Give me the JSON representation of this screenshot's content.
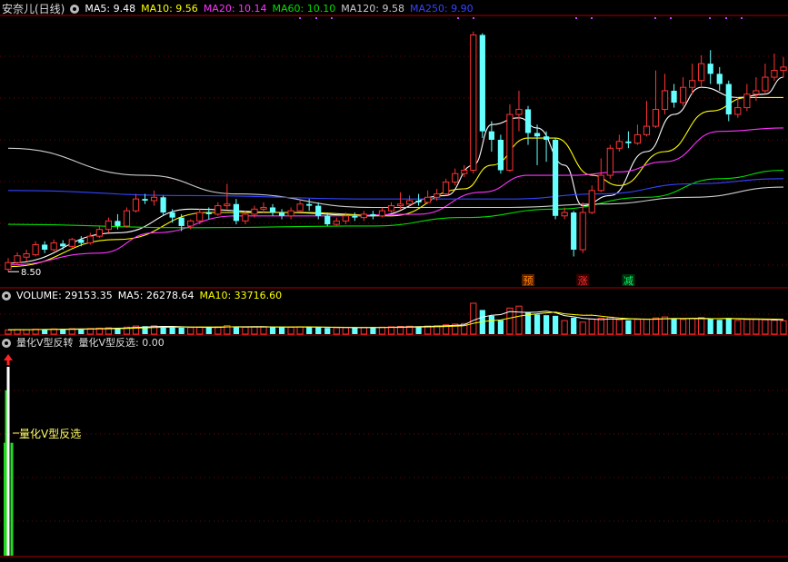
{
  "main_header": {
    "stock_name": "安奈儿(日线)",
    "indicators": [
      {
        "label": "MA5: 9.48",
        "color": "#ffffff"
      },
      {
        "label": "MA10: 9.56",
        "color": "#ffff00"
      },
      {
        "label": "MA20: 10.14",
        "color": "#ff33ff"
      },
      {
        "label": "MA60: 10.10",
        "color": "#00e000"
      },
      {
        "label": "MA120: 9.58",
        "color": "#cccccc"
      },
      {
        "label": "MA250: 9.90",
        "color": "#3344ff"
      }
    ]
  },
  "volume_header": {
    "indicators": [
      {
        "label": "VOLUME: 29153.35",
        "color": "#ffffff"
      },
      {
        "label": "MA5: 26278.64",
        "color": "#ffffff"
      },
      {
        "label": "MA10: 33716.60",
        "color": "#ffff00"
      }
    ]
  },
  "signal_header": {
    "title": "量化V型反转",
    "value_label": "量化V型反选: 0.00"
  },
  "low_price_label": "8.50",
  "markers": [
    {
      "text": "预",
      "color": "#ff8800",
      "bg": "#5a2000"
    },
    {
      "text": "涨",
      "color": "#ff3333",
      "bg": "#3a0000"
    },
    {
      "text": "减",
      "color": "#00ff66",
      "bg": "#003010"
    }
  ],
  "signal_label": "量化V型反选",
  "colors": {
    "up": "#ff3333",
    "down": "#66ffff",
    "grid": "#7a0000",
    "signal_green": "#22dd22",
    "signal_white": "#ffffff",
    "arrow": "#ff2222"
  },
  "chart_data": {
    "type": "candlestick",
    "price_ylim": [
      7.6,
      15.6
    ],
    "candles": [
      [
        8.12,
        8.32,
        8.05,
        8.45
      ],
      [
        8.32,
        8.52,
        8.25,
        8.62
      ],
      [
        8.48,
        8.58,
        8.35,
        8.7
      ],
      [
        8.55,
        8.85,
        8.5,
        8.95
      ],
      [
        8.85,
        8.7,
        8.6,
        8.95
      ],
      [
        8.7,
        8.9,
        8.65,
        9.0
      ],
      [
        8.88,
        8.8,
        8.7,
        8.98
      ],
      [
        8.8,
        9.0,
        8.75,
        9.05
      ],
      [
        9.0,
        8.9,
        8.8,
        9.1
      ],
      [
        8.9,
        9.1,
        8.85,
        9.2
      ],
      [
        9.1,
        9.3,
        9.05,
        9.4
      ],
      [
        9.3,
        9.55,
        9.2,
        9.65
      ],
      [
        9.55,
        9.4,
        9.3,
        9.75
      ],
      [
        9.4,
        9.85,
        9.35,
        9.95
      ],
      [
        9.85,
        10.2,
        9.8,
        10.35
      ],
      [
        10.2,
        10.15,
        10.05,
        10.35
      ],
      [
        10.15,
        10.25,
        10.0,
        10.45
      ],
      [
        10.25,
        9.8,
        9.7,
        10.3
      ],
      [
        9.8,
        9.65,
        9.5,
        9.9
      ],
      [
        9.65,
        9.4,
        9.25,
        9.75
      ],
      [
        9.4,
        9.55,
        9.3,
        9.6
      ],
      [
        9.55,
        9.8,
        9.45,
        9.9
      ],
      [
        9.8,
        9.75,
        9.6,
        9.95
      ],
      [
        9.75,
        10.0,
        9.7,
        10.1
      ],
      [
        10.0,
        10.05,
        9.9,
        10.65
      ],
      [
        10.05,
        9.55,
        9.45,
        10.2
      ],
      [
        9.55,
        9.75,
        9.45,
        9.85
      ],
      [
        9.75,
        9.9,
        9.65,
        10.0
      ],
      [
        9.9,
        9.95,
        9.8,
        10.1
      ],
      [
        9.95,
        9.8,
        9.7,
        10.05
      ],
      [
        9.8,
        9.7,
        9.6,
        9.9
      ],
      [
        9.7,
        9.85,
        9.6,
        9.95
      ],
      [
        9.85,
        10.05,
        9.8,
        10.15
      ],
      [
        10.05,
        10.0,
        9.85,
        10.2
      ],
      [
        10.0,
        9.7,
        9.6,
        10.1
      ],
      [
        9.7,
        9.45,
        9.4,
        9.8
      ],
      [
        9.45,
        9.55,
        9.4,
        9.65
      ],
      [
        9.55,
        9.7,
        9.45,
        9.8
      ],
      [
        9.7,
        9.65,
        9.55,
        9.8
      ],
      [
        9.65,
        9.75,
        9.55,
        9.85
      ],
      [
        9.75,
        9.7,
        9.6,
        9.85
      ],
      [
        9.7,
        9.85,
        9.65,
        9.95
      ],
      [
        9.85,
        10.0,
        9.8,
        10.1
      ],
      [
        10.0,
        10.05,
        9.9,
        10.4
      ],
      [
        10.05,
        10.15,
        10.0,
        10.3
      ],
      [
        10.15,
        10.1,
        10.0,
        10.35
      ],
      [
        10.1,
        10.25,
        10.05,
        10.45
      ],
      [
        10.25,
        10.35,
        10.15,
        10.5
      ],
      [
        10.35,
        10.7,
        10.3,
        10.8
      ],
      [
        10.7,
        10.95,
        10.6,
        11.1
      ],
      [
        10.95,
        11.05,
        10.85,
        11.2
      ],
      [
        11.05,
        15.05,
        10.95,
        15.15
      ],
      [
        15.05,
        12.2,
        12.0,
        15.1
      ],
      [
        12.2,
        11.95,
        11.6,
        12.5
      ],
      [
        11.95,
        11.05,
        10.95,
        12.1
      ],
      [
        11.05,
        12.7,
        11.0,
        13.0
      ],
      [
        12.7,
        12.85,
        12.2,
        13.4
      ],
      [
        12.85,
        12.15,
        11.8,
        12.95
      ],
      [
        12.15,
        12.05,
        11.2,
        12.4
      ],
      [
        12.05,
        11.95,
        11.3,
        12.2
      ],
      [
        11.95,
        9.7,
        9.6,
        12.0
      ],
      [
        9.7,
        9.8,
        9.6,
        9.95
      ],
      [
        9.8,
        8.7,
        8.5,
        9.85
      ],
      [
        8.7,
        9.8,
        8.6,
        10.1
      ],
      [
        9.8,
        10.45,
        9.75,
        10.6
      ],
      [
        10.45,
        10.9,
        10.4,
        11.4
      ],
      [
        10.9,
        11.7,
        10.8,
        11.8
      ],
      [
        11.7,
        11.9,
        11.6,
        12.1
      ],
      [
        11.9,
        11.85,
        11.7,
        12.2
      ],
      [
        11.85,
        12.1,
        11.8,
        12.4
      ],
      [
        12.1,
        12.35,
        12.05,
        13.1
      ],
      [
        12.35,
        12.85,
        12.3,
        14.0
      ],
      [
        12.85,
        13.4,
        12.7,
        13.9
      ],
      [
        13.4,
        13.05,
        12.9,
        13.6
      ],
      [
        13.05,
        13.5,
        12.95,
        13.8
      ],
      [
        13.5,
        13.7,
        13.3,
        14.2
      ],
      [
        13.7,
        14.2,
        13.5,
        14.45
      ],
      [
        14.2,
        13.9,
        13.6,
        14.6
      ],
      [
        13.9,
        13.6,
        13.4,
        14.1
      ],
      [
        13.6,
        12.7,
        12.5,
        13.7
      ],
      [
        12.7,
        12.9,
        12.6,
        13.2
      ],
      [
        12.9,
        13.3,
        12.8,
        13.6
      ],
      [
        13.3,
        13.4,
        13.1,
        13.8
      ],
      [
        13.4,
        13.8,
        13.3,
        14.2
      ],
      [
        13.8,
        14.0,
        13.7,
        14.5
      ],
      [
        14.0,
        14.1,
        13.8,
        14.4
      ]
    ],
    "ma_series": [
      {
        "name": "MA5",
        "color": "#ffffff",
        "anchors": [
          [
            0,
            8.3
          ],
          [
            12,
            9.2
          ],
          [
            20,
            9.9
          ],
          [
            30,
            9.8
          ],
          [
            40,
            9.7
          ],
          [
            48,
            10.3
          ],
          [
            51,
            11.2
          ],
          [
            53,
            12.4
          ],
          [
            56,
            12.6
          ],
          [
            58,
            12.3
          ],
          [
            61,
            11.2
          ],
          [
            63,
            10.0
          ],
          [
            66,
            10.3
          ],
          [
            70,
            11.6
          ],
          [
            73,
            12.7
          ],
          [
            76,
            13.5
          ],
          [
            80,
            13.2
          ],
          [
            83,
            13.3
          ],
          [
            85,
            13.8
          ]
        ]
      },
      {
        "name": "MA10",
        "color": "#ffff00",
        "anchors": [
          [
            0,
            8.2
          ],
          [
            12,
            9.0
          ],
          [
            22,
            9.8
          ],
          [
            32,
            9.8
          ],
          [
            42,
            9.7
          ],
          [
            50,
            10.5
          ],
          [
            53,
            11.2
          ],
          [
            57,
            12.0
          ],
          [
            60,
            12.0
          ],
          [
            64,
            10.9
          ],
          [
            67,
            10.6
          ],
          [
            72,
            11.6
          ],
          [
            77,
            12.8
          ],
          [
            81,
            13.2
          ],
          [
            85,
            13.2
          ]
        ]
      },
      {
        "name": "MA20",
        "color": "#ff33ff",
        "anchors": [
          [
            0,
            8.25
          ],
          [
            10,
            8.6
          ],
          [
            16,
            9.2
          ],
          [
            25,
            9.7
          ],
          [
            35,
            9.7
          ],
          [
            45,
            9.75
          ],
          [
            52,
            10.4
          ],
          [
            57,
            10.9
          ],
          [
            62,
            10.9
          ],
          [
            67,
            11.0
          ],
          [
            72,
            11.3
          ],
          [
            78,
            12.2
          ],
          [
            85,
            12.3
          ]
        ]
      },
      {
        "name": "MA60",
        "color": "#00e000",
        "anchors": [
          [
            0,
            9.45
          ],
          [
            20,
            9.35
          ],
          [
            40,
            9.4
          ],
          [
            50,
            9.65
          ],
          [
            60,
            9.9
          ],
          [
            70,
            10.25
          ],
          [
            78,
            10.8
          ],
          [
            85,
            11.05
          ]
        ]
      },
      {
        "name": "MA120",
        "color": "#cccccc",
        "anchors": [
          [
            0,
            11.7
          ],
          [
            15,
            10.9
          ],
          [
            25,
            10.35
          ],
          [
            40,
            9.95
          ],
          [
            55,
            9.95
          ],
          [
            65,
            10.05
          ],
          [
            75,
            10.25
          ],
          [
            85,
            10.55
          ]
        ]
      },
      {
        "name": "MA250",
        "color": "#3344ff",
        "anchors": [
          [
            0,
            10.45
          ],
          [
            20,
            10.3
          ],
          [
            40,
            10.2
          ],
          [
            55,
            10.2
          ],
          [
            65,
            10.35
          ],
          [
            75,
            10.65
          ],
          [
            85,
            10.8
          ]
        ]
      }
    ],
    "volume": [
      2200,
      2400,
      2300,
      2600,
      2500,
      2700,
      2600,
      2800,
      2700,
      2900,
      3100,
      3300,
      3200,
      3600,
      4200,
      4100,
      4300,
      3800,
      3500,
      3300,
      3400,
      3600,
      3500,
      3700,
      4400,
      3900,
      3600,
      3700,
      3800,
      3600,
      3500,
      3600,
      3800,
      3700,
      3500,
      3200,
      3300,
      3400,
      3300,
      3500,
      3400,
      3600,
      3800,
      4000,
      4100,
      4000,
      4200,
      4300,
      4800,
      5200,
      5500,
      16000,
      12500,
      9500,
      7200,
      13500,
      14500,
      11500,
      10200,
      9800,
      9500,
      7000,
      8500,
      6200,
      7800,
      8200,
      8800,
      7500,
      7200,
      7600,
      7800,
      8400,
      8900,
      7800,
      7600,
      8200,
      8600,
      8100,
      7400,
      8300,
      7100,
      7600,
      7800,
      7400,
      7200,
      6900
    ],
    "signal": {
      "bar_count": 3,
      "white_max": 1.0,
      "green_peak": 0.85,
      "green_side": 0.55
    }
  }
}
